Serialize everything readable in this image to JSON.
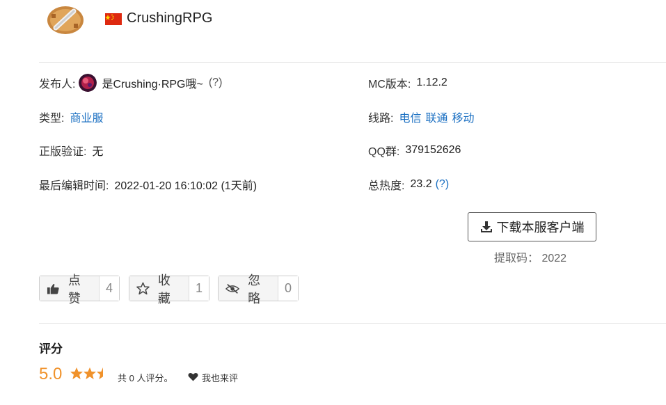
{
  "header": {
    "server_name": "CrushingRPG",
    "flag": "china-flag"
  },
  "info": {
    "publisher_label": "发布人:",
    "publisher_name": "是Crushing·RPG哦~",
    "publisher_help": "(?)",
    "type_label": "类型:",
    "type_value": "商业服",
    "verify_label": "正版验证:",
    "verify_value": "无",
    "edit_label": "最后编辑时间:",
    "edit_value": "2022-01-20 16:10:02 (1天前)",
    "mc_label": "MC版本:",
    "mc_value": "1.12.2",
    "line_label": "线路:",
    "line_values": [
      "电信",
      "联通",
      "移动"
    ],
    "qq_label": "QQ群:",
    "qq_value": "379152626",
    "heat_label": "总热度:",
    "heat_value": "23.2",
    "heat_help": "(?)"
  },
  "download": {
    "button_label": "下载本服客户端",
    "code_text": "提取码： 2022"
  },
  "actions": [
    {
      "icon": "thumbs-up-icon",
      "label": "点赞",
      "count": "4"
    },
    {
      "icon": "star-outline-icon",
      "label": "收藏",
      "count": "1"
    },
    {
      "icon": "eye-slash-icon",
      "label": "忽略",
      "count": "0"
    }
  ],
  "rating": {
    "title": "评分",
    "score": "5.0",
    "stars_filled": 2.5,
    "count_text": "共 0 人评分。",
    "rate_label": "我也来评"
  },
  "colors": {
    "link": "#1a6fc2",
    "accent": "#f0922b"
  }
}
